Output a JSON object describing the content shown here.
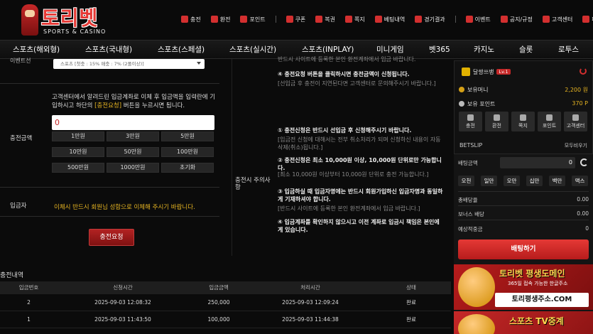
{
  "brand": {
    "name": "토리벳",
    "tagline": "SPORTS & CASINO"
  },
  "top_nav": [
    {
      "label": "충전",
      "icon": "deposit-icon"
    },
    {
      "label": "환전",
      "icon": "withdraw-icon"
    },
    {
      "label": "포인트",
      "icon": "point-icon"
    },
    {
      "label": "쿠폰",
      "icon": "coupon-icon"
    },
    {
      "label": "복권",
      "icon": "lottery-icon"
    },
    {
      "label": "쪽지",
      "icon": "message-icon"
    },
    {
      "label": "베팅내역",
      "icon": "bet-history-icon"
    },
    {
      "label": "경기결과",
      "icon": "result-icon"
    },
    {
      "label": "이벤트",
      "icon": "event-icon"
    },
    {
      "label": "공지/규정",
      "icon": "notice-icon"
    },
    {
      "label": "고객센터",
      "icon": "support-icon"
    },
    {
      "label": "페이버",
      "icon": "favorite-icon"
    }
  ],
  "main_menu": [
    "스포츠(해외형)",
    "스포츠(국내형)",
    "스포츠(스페셜)",
    "스포츠(실시간)",
    "스포츠(INPLAY)",
    "미니게임",
    "벳365",
    "카지노",
    "슬롯",
    "로투스"
  ],
  "form": {
    "cut_label": "이벤트선",
    "bonus_select": "스포츠 [첫충 : 15% 매충 : 7% (2폴이상)]",
    "amount_label": "충전금액",
    "instruction_pre": "고객센터에서 알려드린 입금계좌로 이체 후 입금액을 입력란에 기입하시고 하단의 ",
    "instruction_hl": "[충전요청]",
    "instruction_post": " 버튼을 누르시면 됩니다.",
    "amount_value": "0",
    "amount_buttons": [
      "1만원",
      "3만원",
      "5만원",
      "10만원",
      "50만원",
      "100만원",
      "500만원",
      "1000만원",
      "초기화"
    ],
    "depositor_label": "입금자",
    "depositor_notice": "이체시 반드시 회원님 성함으로 이체해 주시기 바랍니다.",
    "submit": "충전요청"
  },
  "notes": {
    "label": "충전시 주의사항",
    "items": [
      {
        "text": "반드시 사이트에 등록한 본인 환전계좌에서 입금 바랍니다.",
        "style": "g"
      },
      {
        "text": "④ 충전요청 버튼을 클릭하시면 충전금액이 신청됩니다.",
        "style": "b"
      },
      {
        "text": "[선입금 후 충전이 지연된다면 고객센터로 문의해주시기 바랍니다.]",
        "style": "g"
      },
      {
        "text": "① 충전신청은 반드시 선입금 후 신청해주시기 바랍니다.",
        "style": "b"
      },
      {
        "text": "[입금전 신청에 대해서는 전부 취소처리가 되며 신청하신 내용이 자동 삭제(취소)됩니다.]",
        "style": "g"
      },
      {
        "text": "② 충전신청은 최소 10,000원 이상, 10,000원 단위로만 가능합니다.",
        "style": "b"
      },
      {
        "text": "[최소 10,000원 이상부터 10,000원 단위로 충전 가능합니다.]",
        "style": "g"
      },
      {
        "text": "③ 입금하실 때 입금자명에는 반드시 회원가입하신 입금자명과 동일하게 기재하셔야 합니다.",
        "style": "b"
      },
      {
        "text": "[반드시 사이트에 등록한 본인 환전계좌에서 입금 바랍니다.]",
        "style": "g"
      },
      {
        "text": "④ 입금계좌를 확인하지 않으시고 이전 계좌로 입금시 책임은 본인에게 있습니다.",
        "style": "b"
      }
    ]
  },
  "history": {
    "title": "충전내역",
    "columns": [
      "입금번호",
      "신청시간",
      "입금금액",
      "처리시간",
      "상태"
    ],
    "rows": [
      [
        "2",
        "2025-09-03 12:08:32",
        "250,000",
        "2025-09-03 12:09:24",
        "완료"
      ],
      [
        "1",
        "2025-09-03 11:43:50",
        "100,000",
        "2025-09-03 11:44:38",
        "완료"
      ]
    ]
  },
  "user": {
    "name": "달쌍쓰뱅",
    "level": "Lv.1",
    "money_label": "보유머니",
    "money": "2,200 원",
    "point_label": "보유 포인트",
    "point": "370 P",
    "quick": [
      "충전",
      "환전",
      "쪽지",
      "포인트",
      "고객센터"
    ]
  },
  "betslip": {
    "title": "BETSLIP",
    "delete_all": "모두비우기",
    "amount_label": "배팅금액",
    "amount_value": "0",
    "chips": [
      "오천",
      "일만",
      "오만",
      "십만",
      "백만",
      "맥스"
    ],
    "total_odds_label": "총배당율",
    "total_odds": "0.00",
    "bonus_label": "보너스 배당",
    "bonus": "0.00",
    "expected_label": "예상적중금",
    "expected": "0",
    "bet_button": "배팅하기"
  },
  "banners": {
    "b1_title": "토리벳 평생도메인",
    "b1_sub": "365일 접속 가능한 한글주소",
    "b1_url": "토리평생주소.COM",
    "b2_title": "스포츠 TV중계"
  }
}
